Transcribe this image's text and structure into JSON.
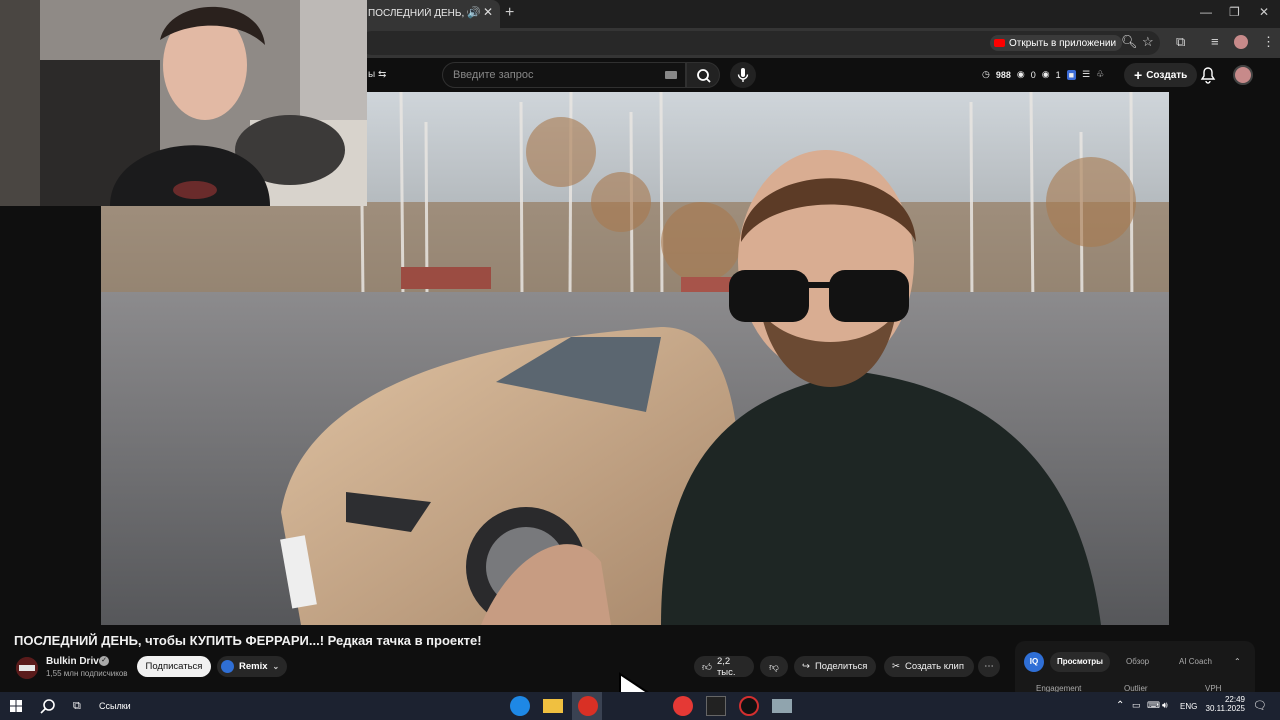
{
  "browser": {
    "tab_title": "ПОСЛЕДНИЙ ДЕНЬ, чтобы",
    "tab_close": "✕",
    "new_tab": "+",
    "open_in_app_label": "Открыть в приложении"
  },
  "youtube_header": {
    "filter_fragment": "ы ⇆",
    "search_placeholder": "Введите запрос",
    "stats": {
      "views": "988",
      "b": "0",
      "c": "1"
    },
    "create_label": "Создать"
  },
  "video": {
    "title": "ПОСЛЕДНИЙ ДЕНЬ, чтобы КУПИТЬ ФЕРРАРИ...! Редкая тачка в проекте!",
    "channel_name": "Bulkin Drive",
    "subscribers": "1,55 млн подписчиков",
    "subscribe_label": "Подписаться",
    "remix_label": "Remix",
    "likes": "2,2 тыс.",
    "share_label": "Поделиться",
    "clip_label": "Создать клип"
  },
  "side_panel": {
    "tabs": [
      "Просмотры",
      "Обзор",
      "AI Coach"
    ],
    "columns": [
      "Engagement",
      "Outlier",
      "VPH"
    ],
    "logo_text": "IQ"
  },
  "taskbar": {
    "links_label": "Ссылки",
    "language": "ENG",
    "time": "22:49",
    "date": "30.11.2025"
  },
  "colors": {
    "youtube_red": "#ff0000",
    "background": "#0f0f0f",
    "pill": "#272727"
  }
}
